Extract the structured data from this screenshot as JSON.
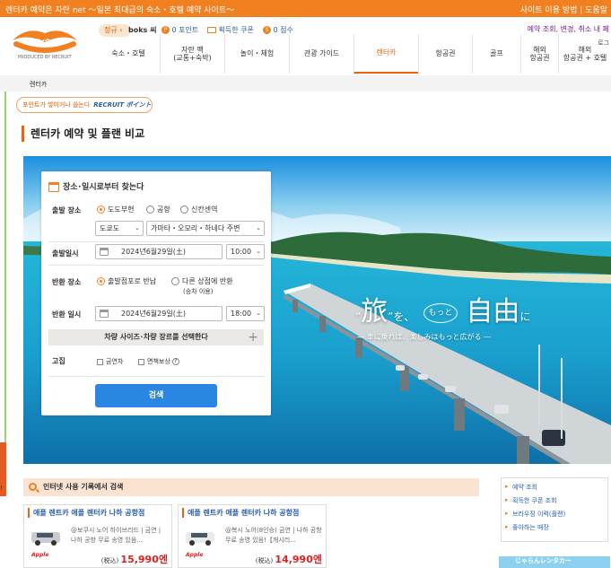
{
  "topbar": {
    "site_text": "렌터카 예약은 자란 net ～일본 최대급의 숙소・호텔 예약 사이트～",
    "right_text": "사이트 이용 방법 | 도움말"
  },
  "header": {
    "logo_sub": "PRODUCED BY RECRUIT",
    "member_badge": "정규",
    "user_name": "boks 씨",
    "points": "0 포인트",
    "coupons": "획득한 쿠폰",
    "score": "0 점수",
    "util_links": "예약 조회, 변경, 취소 내 페",
    "util_links2": "로그"
  },
  "nav": [
    {
      "label": "숙소・호텔"
    },
    {
      "label": "자란 팩\n(교통+숙박)"
    },
    {
      "label": "놀이・체험"
    },
    {
      "label": "관광 가이드"
    },
    {
      "label": "렌터카",
      "active": true
    },
    {
      "label": "항공권"
    },
    {
      "label": "골프"
    },
    {
      "label": "해외\n항공권"
    },
    {
      "label": "해외\n항공권 + 호텔"
    }
  ],
  "breadcrumb": "렌터카",
  "point_pill": {
    "text": "포인트가 쌓이거나 쓸는다",
    "brand": "RECRUIT ポイント"
  },
  "page_title": "렌터카 예약 및 플랜 비교",
  "hero": {
    "slogan_main": "旅",
    "slogan_o": "を、",
    "slogan_circle": "もっと",
    "slogan_jiyu": "自由",
    "slogan_ni": "に",
    "slogan_sub": "― 車に乗れば、楽しみはもっと広がる ―"
  },
  "search": {
    "title": "장소･일시로부터 찾는다",
    "depart_place_label": "출발 장소",
    "depart_options": [
      "도도부현",
      "공항",
      "신칸센역"
    ],
    "prefecture": "도쿄도",
    "area": "가마타・오모리・하네다 주변",
    "depart_time_label": "출발일시",
    "depart_date": "2024년6월29일(土)",
    "depart_time": "10:00",
    "return_place_label": "반환 장소",
    "return_options": [
      "출발점포로 반납",
      "다른 상점에 반환"
    ],
    "return_note": "(승차 이용)",
    "return_time_label": "반환 일시",
    "return_date": "2024년6월29일(土)",
    "return_time": "18:00",
    "car_size_label": "차량 사이즈･차량 장르를 선택한다",
    "sticky_label": "고집",
    "no_smoking": "금연차",
    "insurance": "면책보상",
    "search_button": "검색"
  },
  "history": {
    "title": "인터넷 사용 기록에서 검색",
    "cards": [
      {
        "title": "애플 렌트카 애플 렌터카 나하 공항점",
        "desc": "@보쿠시 노어 하이브리드 | 금연 | 나하 공항 무료 송영 있음...",
        "price_prefix": "(税込)",
        "price": "15,990엔",
        "brand": "Apple"
      },
      {
        "title": "애플 렌트카 애플 렌터카 나하 공항점",
        "desc": "@복시 노어(8인승) 금연 | 나하 공항 무료 송영 있음!【캐시리...",
        "price_prefix": "(税込)",
        "price": "14,990엔",
        "brand": "Apple"
      }
    ]
  },
  "sidebox": [
    "예약 조회",
    "획득한 쿠폰 조회",
    "브라우징 이력(플랜)",
    "좋아하는 매장"
  ],
  "side_banner": "じゃらんレンタカー",
  "left_cut": "!"
}
